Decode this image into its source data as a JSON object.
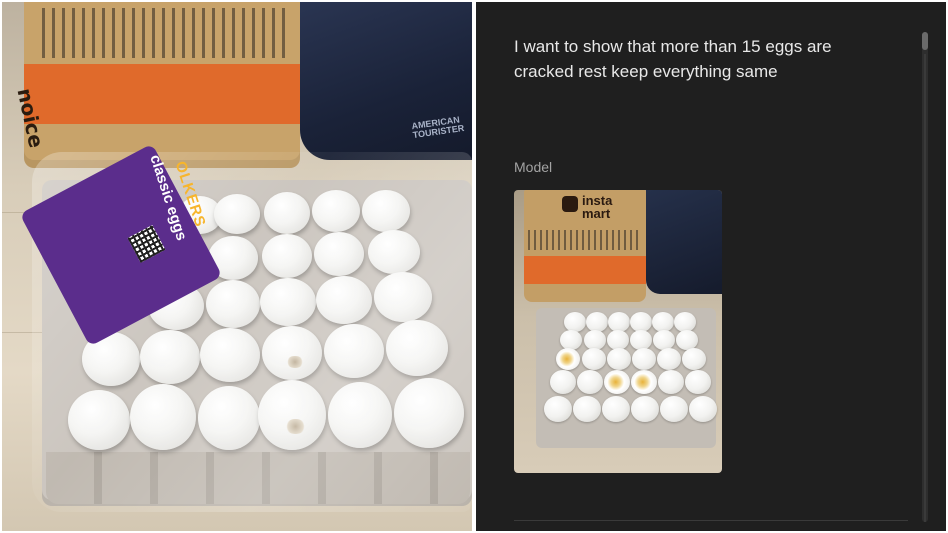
{
  "prompt": {
    "text": "I want to show that more than 15 eggs are cracked rest keep everything same"
  },
  "response": {
    "speaker_label": "Model"
  },
  "left_photo": {
    "bag_text": "noice",
    "blue_bag_text": "AMERICAN TOURISTER",
    "product_brand": "OLKERS",
    "product_name": "classic eggs"
  },
  "generated_image": {
    "logo_text": "insta mart"
  },
  "colors": {
    "chat_background": "#1f1f1f",
    "prompt_text": "#e8e8e8",
    "model_label": "#a3a3a3",
    "bag_orange": "#e06a2b",
    "label_purple": "#5b2d8c"
  }
}
